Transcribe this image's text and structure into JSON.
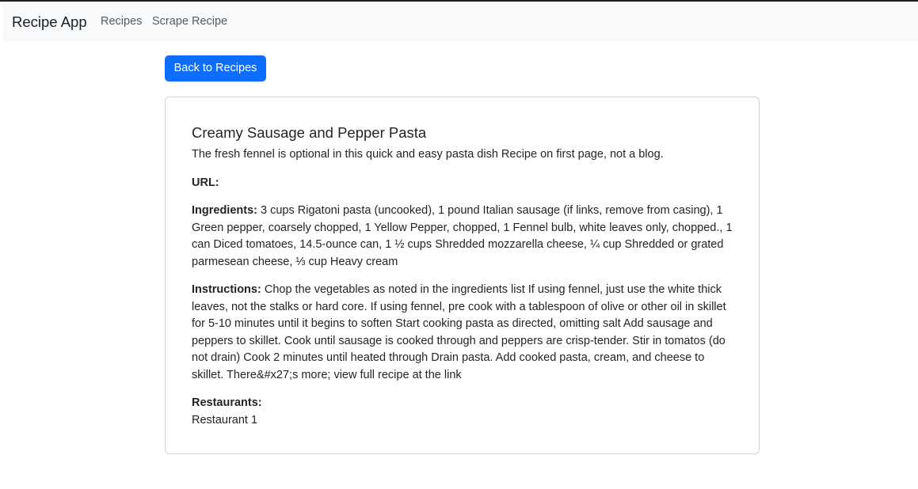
{
  "navbar": {
    "brand": "Recipe App",
    "links": [
      {
        "label": "Recipes"
      },
      {
        "label": "Scrape Recipe"
      }
    ]
  },
  "back_button": {
    "label": "Back to Recipes"
  },
  "recipe": {
    "title": "Creamy Sausage and Pepper Pasta",
    "description": "The fresh fennel is optional in this quick and easy pasta dish Recipe on first page, not a blog.",
    "url_label": "URL:",
    "url_value": "",
    "ingredients_label": "Ingredients:",
    "ingredients": "3 cups Rigatoni pasta (uncooked), 1 pound Italian sausage (if links, remove from casing), 1 Green pepper, coarsely chopped, 1 Yellow Pepper, chopped, 1 Fennel bulb, white leaves only, chopped., 1 can Diced tomatoes, 14.5-ounce can, 1 ½ cups Shredded mozzarella cheese, ¼ cup Shredded or grated parmesean cheese, ⅓ cup Heavy cream",
    "instructions_label": "Instructions:",
    "instructions": "Chop the vegetables as noted in the ingredients list If using fennel, just use the white thick leaves, not the stalks or hard core. If using fennel, pre cook with a tablespoon of olive or other oil in skillet for 5-10 minutes until it begins to soften Start cooking pasta as directed, omitting salt Add sausage and peppers to skillet. Cook until sausage is cooked through and peppers are crisp-tender. Stir in tomatos (do not drain) Cook 2 minutes until heated through Drain pasta. Add cooked pasta, cream, and cheese to skillet. There&#x27;s more; view full recipe at the link",
    "restaurants_label": "Restaurants:",
    "restaurants": [
      "Restaurant 1"
    ]
  },
  "colors": {
    "primary": "#0d6efd",
    "navbar_bg": "#f8f9fa",
    "text": "#212529"
  }
}
